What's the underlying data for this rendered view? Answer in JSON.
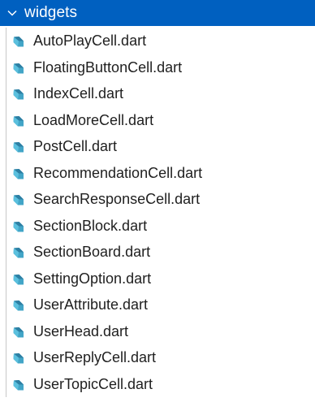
{
  "explorer": {
    "folder": {
      "name": "widgets",
      "expanded": true,
      "icon": "chevron-down-icon"
    },
    "file_icon": "dart-file-icon",
    "colors": {
      "selected_background": "#0060c0",
      "selected_text": "#ffffff",
      "dart_icon": "#42a5c7",
      "file_text": "#1f1f1f"
    },
    "files": [
      {
        "name": "AutoPlayCell.dart"
      },
      {
        "name": "FloatingButtonCell.dart"
      },
      {
        "name": "IndexCell.dart"
      },
      {
        "name": "LoadMoreCell.dart"
      },
      {
        "name": "PostCell.dart"
      },
      {
        "name": "RecommendationCell.dart"
      },
      {
        "name": "SearchResponseCell.dart"
      },
      {
        "name": "SectionBlock.dart"
      },
      {
        "name": "SectionBoard.dart"
      },
      {
        "name": "SettingOption.dart"
      },
      {
        "name": "UserAttribute.dart"
      },
      {
        "name": "UserHead.dart"
      },
      {
        "name": "UserReplyCell.dart"
      },
      {
        "name": "UserTopicCell.dart"
      }
    ]
  }
}
